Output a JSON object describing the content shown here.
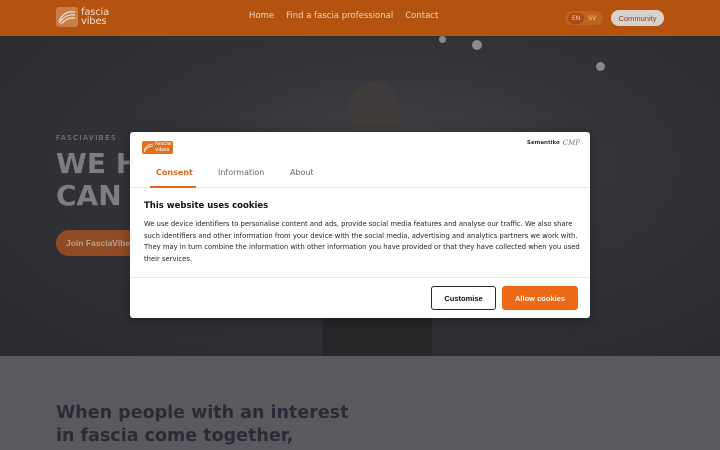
{
  "header": {
    "logo_text_line1": "fascia",
    "logo_text_line2": "vibes",
    "nav": [
      "Home",
      "Find a fascia professional",
      "Contact"
    ],
    "languages": [
      "EN",
      "SV"
    ],
    "active_language": "EN",
    "community_label": "Community",
    "brand_color": "#b4530f"
  },
  "hero": {
    "eyebrow": "FASCIAVIBES",
    "headline_line1": "WE H",
    "headline_line2": "CAN H",
    "cta_label": "Join FasciaVibe"
  },
  "lower": {
    "heading": "When people with an interest in fascia come together, things"
  },
  "cookie_dialog": {
    "logo_text_line1": "fascia",
    "logo_text_line2": "vibes",
    "powered_by": "Semantiko",
    "powered_by_mark": "CMP",
    "tabs": [
      "Consent",
      "Information",
      "About"
    ],
    "active_tab": "Consent",
    "title": "This website uses cookies",
    "body": "We use device identifiers to personalise content and ads, provide social media features and analyse our traffic. We also share such identifiers and other information from your device with the social media, advertising and analytics partners we work with. They may in turn combine the information with other information you have provided or that they have collected when you used their services.",
    "customise_label": "Customise",
    "allow_label": "Allow cookies",
    "accent_color": "#ec6a16"
  }
}
